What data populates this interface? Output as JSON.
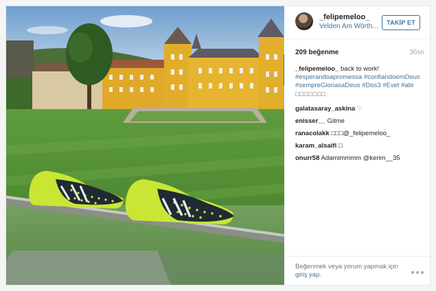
{
  "post": {
    "username": "_felipemeloo_",
    "location": "Velden Am Wörth...",
    "follow_label": "TAKİP ET",
    "likes": "209 beğenme",
    "time": "36sn"
  },
  "comments": [
    {
      "author": "_felipemeloo_",
      "text": " back to work!",
      "tags": "#esperandoapromessa #confiandoemDeus #sempreGloriasaDeus #Dos3 #Evet #abi",
      "extra": "□□□□□□□"
    },
    {
      "author": "galatasaray_askina",
      "text": " ♡"
    },
    {
      "author": "enisser__",
      "text": " Gitme"
    },
    {
      "author": "ranacolakk",
      "text": " □□□@_felipemeloo_"
    },
    {
      "author": "karam_alsaifi",
      "text": " □"
    },
    {
      "author": "onurr58",
      "text": " Adamimmmm @kerim__35"
    }
  ],
  "footer": {
    "prompt": "Beğenmek veya yorum yapmak için ",
    "login_label": "giriş yap",
    "prompt_end": "."
  },
  "icons": {
    "avatar": "profile-avatar",
    "more": "more-options-icon"
  },
  "colors": {
    "link": "#3f729b",
    "follow_border": "#3f729b",
    "muted": "#a5a7aa"
  }
}
